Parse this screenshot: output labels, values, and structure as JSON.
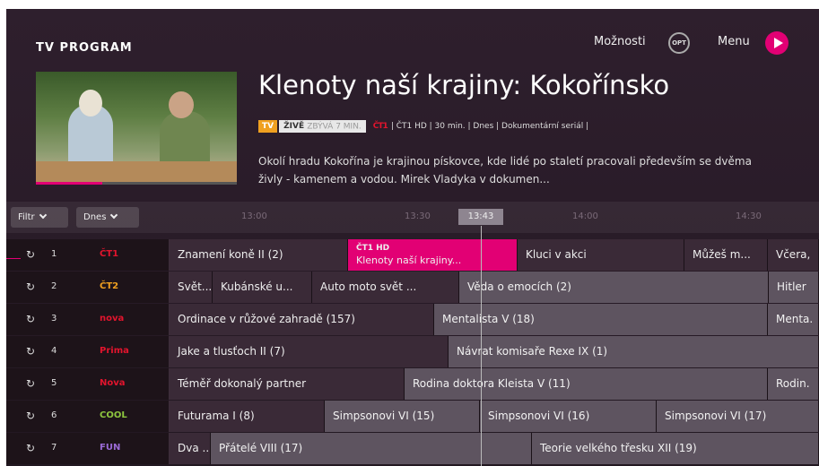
{
  "header": {
    "title": "TV PROGRAM",
    "options_label": "Možnosti",
    "options_button": "OPT",
    "menu_label": "Menu"
  },
  "show": {
    "title": "Klenoty naší krajiny: Kokořínsko",
    "badge_tv": "TV",
    "badge_live": "ŽIVĚ",
    "badge_remaining": "ZBÝVÁ 7 MIN.",
    "channel_logo": "ČT1",
    "meta": "| ČT1 HD | 30 min. | Dnes | Dokumentární seriál |",
    "description": "Okolí hradu Kokořína je krajinou pískovce, kde lidé po staletí pracovali především se dvěma živly - kamenem a vodou. Mirek Vladyka v dokumen..."
  },
  "filters": {
    "filter_label": "Filtr",
    "day_label": "Dnes"
  },
  "timeline": {
    "ticks": [
      "13:00",
      "13:30",
      "14:00",
      "14:30"
    ],
    "now": "13:43"
  },
  "channels": [
    {
      "num": "1",
      "logo": "ČT1",
      "color": "#e2142d"
    },
    {
      "num": "2",
      "logo": "ČT2",
      "color": "#f0a020"
    },
    {
      "num": "3",
      "logo": "nova",
      "color": "#e2142d"
    },
    {
      "num": "4",
      "logo": "Prima",
      "color": "#e2142d"
    },
    {
      "num": "5",
      "logo": "Nova",
      "color": "#e2142d"
    },
    {
      "num": "6",
      "logo": "COOL",
      "color": "#8ec63f"
    },
    {
      "num": "7",
      "logo": "FUN",
      "color": "#9b6bd6"
    }
  ],
  "programs": [
    [
      {
        "title": "Znamení koně II (2)",
        "state": "cur"
      },
      {
        "channel": "ČT1 HD",
        "title": "Klenoty naší krajiny...",
        "state": "sel"
      },
      {
        "title": "Kluci v akci",
        "state": "cur"
      },
      {
        "title": "Můžeš m...",
        "state": "cur"
      },
      {
        "title": "Včera,",
        "state": "cur"
      }
    ],
    [
      {
        "title": "Svět...",
        "state": "cur"
      },
      {
        "title": "Kubánské u...",
        "state": "cur"
      },
      {
        "title": "Auto moto svět ...",
        "state": "cur"
      },
      {
        "title": "Věda o emocích (2)",
        "state": "fut"
      },
      {
        "title": "Hitler",
        "state": "fut"
      }
    ],
    [
      {
        "title": "Ordinace v růžové zahradě (157)",
        "state": "cur"
      },
      {
        "title": "Mentalista V (18)",
        "state": "fut"
      },
      {
        "title": "Menta.",
        "state": "fut"
      }
    ],
    [
      {
        "title": "Jake a tlusťoch II (7)",
        "state": "cur"
      },
      {
        "title": "Návrat komisaře Rexe IX (1)",
        "state": "fut"
      }
    ],
    [
      {
        "title": "Téměř dokonalý partner",
        "state": "cur"
      },
      {
        "title": "Rodina doktora Kleista V (11)",
        "state": "fut"
      },
      {
        "title": "Rodin.",
        "state": "fut"
      }
    ],
    [
      {
        "title": "Futurama I (8)",
        "state": "cur"
      },
      {
        "title": "Simpsonovi VI (15)",
        "state": "fut"
      },
      {
        "title": "Simpsonovi VI (16)",
        "state": "fut"
      },
      {
        "title": "Simpsonovi VI (17)",
        "state": "fut"
      }
    ],
    [
      {
        "title": "Dva ...",
        "state": "cur"
      },
      {
        "title": "Přátelé VIII (17)",
        "state": "fut"
      },
      {
        "title": "Teorie velkého třesku XII (19)",
        "state": "fut"
      }
    ]
  ]
}
